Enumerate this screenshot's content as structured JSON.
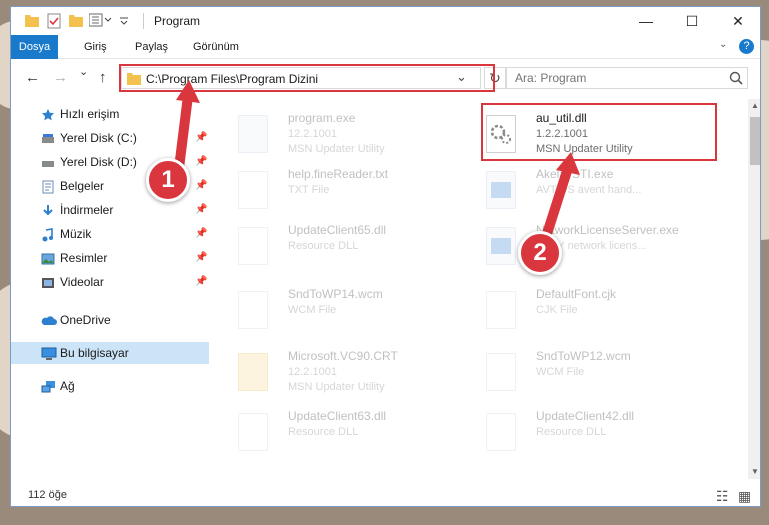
{
  "window": {
    "title": "Program",
    "minimize": "—",
    "maximize": "☐",
    "close": "✕"
  },
  "ribbon": {
    "file_tab": "Dosya",
    "tabs": [
      "Giriş",
      "Paylaş",
      "Görünüm"
    ],
    "help": "?"
  },
  "nav": {
    "back": "←",
    "forward": "→",
    "recent": "⌄",
    "up": "↑",
    "refresh": "↻",
    "dropdown": "⌄"
  },
  "address": {
    "path": "C:\\Program Files\\Program Dizini"
  },
  "search": {
    "placeholder": "Ara: Program"
  },
  "sidebar": {
    "items": [
      {
        "label": "Hızlı erişim",
        "icon": "star-icon"
      },
      {
        "label": "Yerel Disk (C:)",
        "icon": "drive-icon",
        "pinned": true
      },
      {
        "label": "Yerel Disk (D:)",
        "icon": "drive-icon",
        "pinned": true
      },
      {
        "label": "Belgeler",
        "icon": "documents-icon",
        "pinned": true
      },
      {
        "label": "İndirmeler",
        "icon": "download-icon",
        "pinned": true
      },
      {
        "label": "Müzik",
        "icon": "music-icon",
        "pinned": true
      },
      {
        "label": "Resimler",
        "icon": "pictures-icon",
        "pinned": true
      },
      {
        "label": "Videolar",
        "icon": "video-icon",
        "pinned": true
      },
      {
        "label": "OneDrive",
        "icon": "cloud-icon"
      },
      {
        "label": "Bu bilgisayar",
        "icon": "computer-icon",
        "selected": true
      },
      {
        "label": "Ağ",
        "icon": "network-icon"
      }
    ]
  },
  "files": [
    {
      "name": "program.exe",
      "line1": "12.2.1001",
      "line2": "MSN Updater Utility",
      "kind": "exe",
      "highlighted": false
    },
    {
      "name": "au_util.dll",
      "line1": "1.2.2.1001",
      "line2": "MSN Updater Utility",
      "kind": "dll",
      "highlighted": true
    },
    {
      "name": "help.fineReader.txt",
      "line1": "TXT File",
      "line2": "",
      "kind": "txt",
      "highlighted": false
    },
    {
      "name": "AkelaySTI.exe",
      "line1": "AVT DS avent hand...",
      "line2": "",
      "kind": "exe",
      "highlighted": false
    },
    {
      "name": "UpdateClient65.dll",
      "line1": "Resource DLL",
      "line2": "",
      "kind": "dll",
      "highlighted": false
    },
    {
      "name": "NetworkLicenseServer.exe",
      "line1": "ASFY network licens...",
      "line2": "",
      "kind": "exe",
      "highlighted": false
    },
    {
      "name": "SndToWP14.wcm",
      "line1": "WCM File",
      "line2": "",
      "kind": "txt",
      "highlighted": false
    },
    {
      "name": "DefaultFont.cjk",
      "line1": "CJK File",
      "line2": "",
      "kind": "txt",
      "highlighted": false
    },
    {
      "name": "Microsoft.VC90.CRT",
      "line1": "12.2.1001",
      "line2": "MSN Updater Utility",
      "kind": "folder",
      "highlighted": false
    },
    {
      "name": "SndToWP12.wcm",
      "line1": "WCM File",
      "line2": "",
      "kind": "txt",
      "highlighted": false
    },
    {
      "name": "UpdateClient63.dll",
      "line1": "Resource DLL",
      "line2": "",
      "kind": "dll",
      "highlighted": false
    },
    {
      "name": "UpdateClient42.dll",
      "line1": "Resource DLL",
      "line2": "",
      "kind": "dll",
      "highlighted": false
    }
  ],
  "status": {
    "count": "112 öğe",
    "view_details": "☷",
    "view_icons": "▦"
  },
  "markers": [
    "1",
    "2"
  ],
  "colors": {
    "accent": "#1979ca",
    "highlight": "#d9363e",
    "selected": "#cce4f7"
  }
}
